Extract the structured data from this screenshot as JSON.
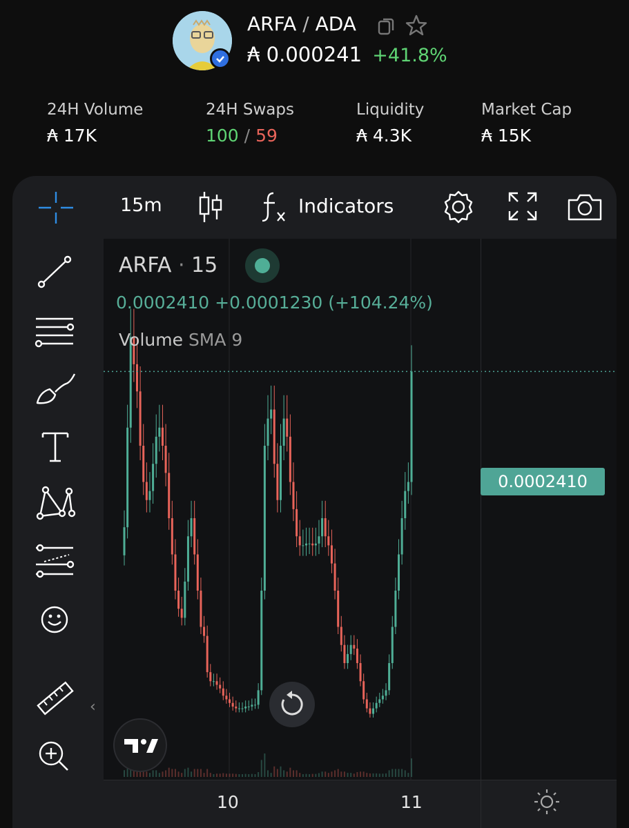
{
  "token": {
    "symbol": "ARFA",
    "separator": "/",
    "quote": "ADA",
    "price": "₳ 0.000241",
    "change": "+41.8%"
  },
  "stats": [
    {
      "label": "24H Volume",
      "value": "₳ 17K"
    },
    {
      "label": "24H Swaps",
      "buys": "100",
      "divider": "/",
      "sells": "59"
    },
    {
      "label": "Liquidity",
      "value": "₳ 4.3K"
    },
    {
      "label": "Market Cap",
      "value": "₳ 15K"
    }
  ],
  "toolbar": {
    "interval": "15m",
    "indicators_label": "Indicators"
  },
  "legend": {
    "symbol": "ARFA",
    "dot": "·",
    "interval": "15",
    "ohlc": "0.0002410  +0.0001230 (+104.24%)",
    "volume_label": "Volume",
    "volume_param": "SMA 9"
  },
  "last_price_tag": "0.0002410",
  "xaxis": [
    "10",
    "11"
  ],
  "collapse_glyph": "‹",
  "colors": {
    "up": "#4fae96",
    "down": "#e8645a",
    "accent": "#2f8de4",
    "positive": "#5fd474"
  },
  "icons": [
    "crosshair-icon",
    "trend-line-icon",
    "fib-levels-icon",
    "brush-icon",
    "text-icon",
    "pattern-icon",
    "forecast-icon",
    "emoji-icon",
    "ruler-icon",
    "zoom-in-icon",
    "candles-icon",
    "fx-icon",
    "gear-icon",
    "fullscreen-icon",
    "camera-icon",
    "copy-icon",
    "star-icon",
    "reset-icon",
    "tradingview-logo",
    "sun-icon"
  ],
  "chart_data": {
    "type": "candlestick",
    "series": [
      {
        "name": "ARFA",
        "close": [
          0.000155,
          0.00021,
          0.00026,
          0.000245,
          0.00023,
          0.0002,
          0.00018,
          0.00017,
          0.000175,
          0.00019,
          0.000205,
          0.00021,
          0.0002,
          0.000185,
          0.00016,
          0.00014,
          0.00012,
          0.00011,
          0.000105,
          0.000125,
          0.00015,
          0.00016,
          0.00014,
          0.00012,
          0.0001,
          9.5e-05,
          7.5e-05,
          7e-05,
          7e-05,
          6.8e-05,
          6.6e-05,
          6.2e-05,
          6e-05,
          5.8e-05,
          5.6e-05,
          5.5e-05,
          5.5e-05,
          5.5e-05,
          5.6e-05,
          5.6e-05,
          5.7e-05,
          5.7e-05,
          6.5e-05,
          0.00012,
          0.0002,
          0.000215,
          0.00022,
          0.00019,
          0.00017,
          0.0002,
          0.000215,
          0.000205,
          0.00018,
          0.000165,
          0.00015,
          0.000145,
          0.000145,
          0.000146,
          0.000146,
          0.000145,
          0.000146,
          0.00015,
          0.00016,
          0.00015,
          0.000145,
          0.000135,
          0.00012,
          0.0001,
          9e-05,
          8e-05,
          8.5e-05,
          9e-05,
          8.8e-05,
          8e-05,
          7e-05,
          6e-05,
          5.5e-05,
          5.2e-05,
          5.5e-05,
          5.8e-05,
          6e-05,
          6.2e-05,
          6.5e-05,
          8e-05,
          0.0001,
          0.00012,
          0.00014,
          0.00016,
          0.000175,
          0.00018,
          0.000241
        ]
      }
    ],
    "xlabel": "",
    "ylabel": "",
    "x_ticks": [
      "10",
      "11"
    ],
    "last_value": 0.000241,
    "price_line": true,
    "grid": false
  }
}
